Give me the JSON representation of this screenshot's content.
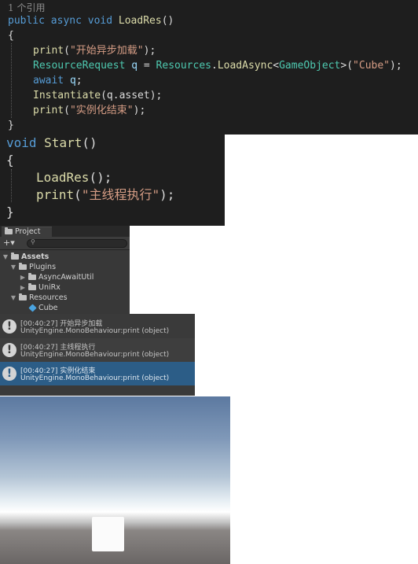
{
  "code_block_1": {
    "reference_hint": "1 个引用",
    "signature": {
      "kw1": "public",
      "kw2": "async",
      "kw3": "void",
      "name": "LoadRes",
      "params": "()"
    },
    "open_brace": "{",
    "close_brace": "}",
    "lines": {
      "l1": {
        "call": "print",
        "open": "(",
        "str": "\"开始异步加载\"",
        "close": ");"
      },
      "l2": {
        "type": "ResourceRequest",
        "var": "q",
        "eq": " = ",
        "cls": "Resources",
        "dot": ".",
        "method": "LoadAsync",
        "lt": "<",
        "generic": "GameObject",
        "gt": ">",
        "open": "(",
        "str": "\"Cube\"",
        "close": ");"
      },
      "l3": {
        "kw": "await",
        "var": "q",
        "end": ";"
      },
      "l4": {
        "call": "Instantiate",
        "args": "(q.asset);"
      },
      "l5": {
        "call": "print",
        "open": "(",
        "str": "\"实例化结束\"",
        "close": ");"
      }
    }
  },
  "code_block_2": {
    "signature": {
      "kw": "void",
      "name": "Start",
      "params": "()"
    },
    "open_brace": "{",
    "close_brace": "}",
    "lines": {
      "l1": {
        "call": "LoadRes",
        "args": "();"
      },
      "l2": {
        "call": "print",
        "open": "(",
        "str": "\"主线程执行\"",
        "close": ");"
      }
    }
  },
  "project_panel": {
    "tab_label": "Project",
    "add_label": "+▾",
    "search_icon": "magnifier-icon",
    "tree": {
      "assets": "Assets",
      "plugins": "Plugins",
      "async_await_util": "AsyncAwaitUtil",
      "unirx": "UniRx",
      "resources": "Resources",
      "cube": "Cube"
    }
  },
  "console": {
    "entries": [
      {
        "time": "[00:40:27]",
        "message": "开始异步加载",
        "source": "UnityEngine.MonoBehaviour:print (object)",
        "selected": false
      },
      {
        "time": "[00:40:27]",
        "message": "主线程执行",
        "source": "UnityEngine.MonoBehaviour:print (object)",
        "selected": false
      },
      {
        "time": "[00:40:27]",
        "message": "实例化结束",
        "source": "UnityEngine.MonoBehaviour:print (object)",
        "selected": true
      }
    ],
    "icon": "info-icon",
    "colors": {
      "row_a": "#3a3a3a",
      "row_b": "#3e3e3e",
      "selected": "#2c5d87"
    }
  },
  "colors": {
    "keyword": "#569cd6",
    "method": "#dcdcaa",
    "type": "#4ec9b0",
    "string": "#d69d85",
    "variable": "#9cdcfe",
    "code_bg": "#1e1e1e"
  }
}
